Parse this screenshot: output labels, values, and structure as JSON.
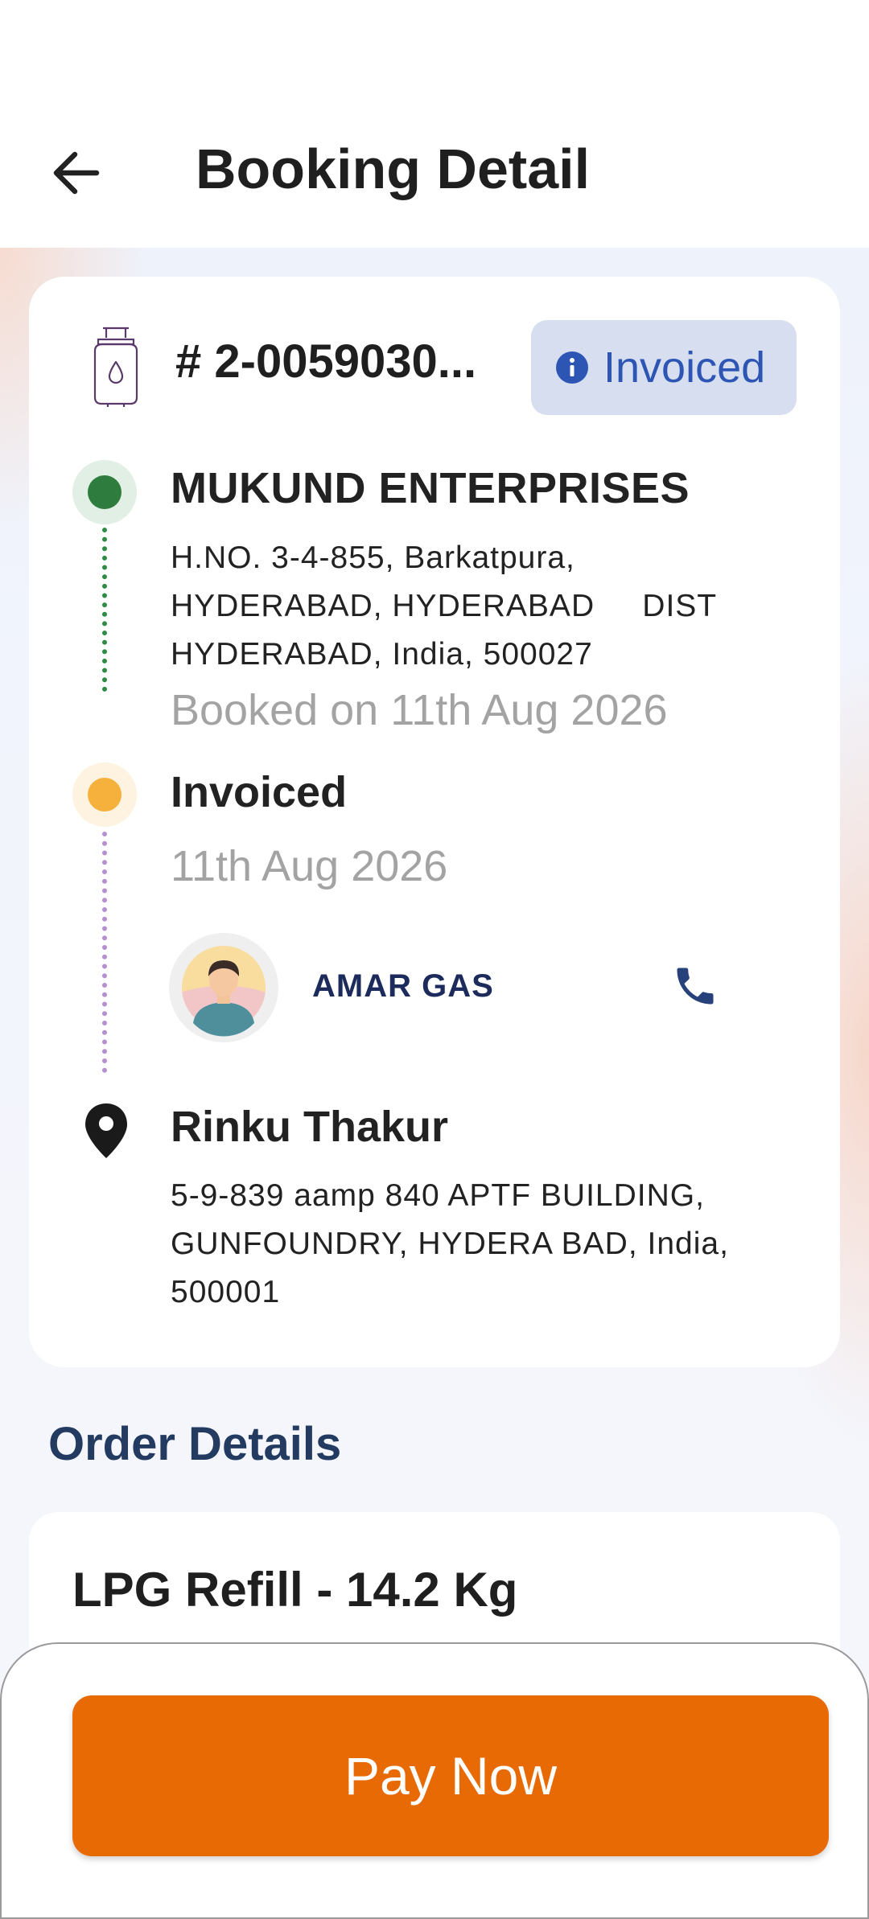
{
  "header": {
    "title": "Booking Detail",
    "back_icon": "arrow-left-icon"
  },
  "booking": {
    "id": "# 2-0059030...",
    "status": "Invoiced",
    "status_color": "#2d56b4",
    "status_bg": "#d6def0"
  },
  "timeline": {
    "seller": {
      "name": "MUKUND ENTERPRISES",
      "address_lines": [
        "H.NO. 3-4-855, Barkatpura,",
        "HYDERABAD, HYDERABAD     DIST",
        "HYDERABAD, India, 500027"
      ],
      "booked_on": "Booked on 11th Aug 2026",
      "dot_color": "#2e7d3e"
    },
    "invoice": {
      "title": "Invoiced",
      "date": "11th Aug 2026",
      "dot_color": "#f6b13d",
      "distributor": {
        "name": "AMAR GAS",
        "avatar_icon": "person-avatar-icon",
        "call_icon": "phone-icon"
      }
    },
    "delivery": {
      "name": "Rinku Thakur",
      "address_lines": [
        "5-9-839 aamp 840 APTF BUILDING,",
        "GUNFOUNDRY, HYDERA BAD, India,",
        "500001"
      ],
      "pin_icon": "location-pin-icon"
    }
  },
  "order_details": {
    "title": "Order Details",
    "product": "LPG Refill - 14.2 Kg"
  },
  "footer": {
    "pay_label": "Pay Now",
    "pay_color": "#e86a05"
  }
}
